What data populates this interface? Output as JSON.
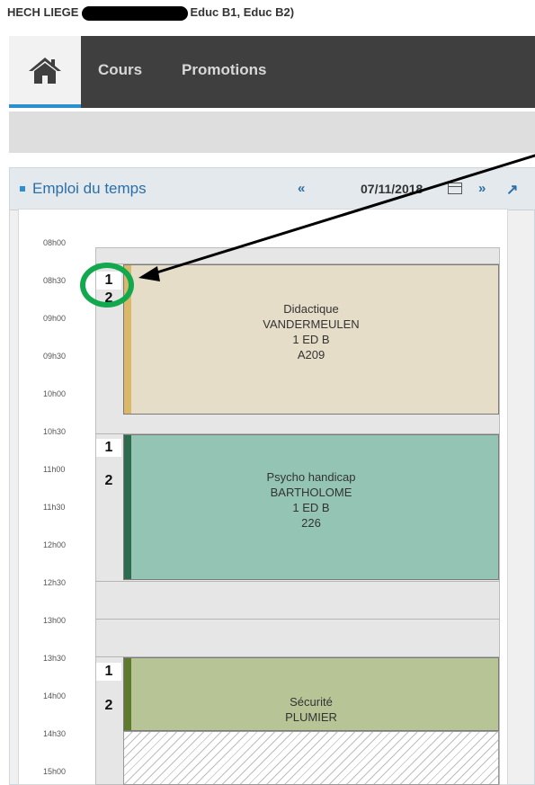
{
  "header": {
    "title_prefix": "HECH LIEGE",
    "title_suffix": "Educ B1, Educ B2)"
  },
  "navbar": {
    "home_icon": "home-icon",
    "links": [
      {
        "label": "Cours"
      },
      {
        "label": "Promotions"
      }
    ]
  },
  "schedule": {
    "title": "Emploi du temps",
    "prev_icon": "double-chevron-left-icon",
    "date": "07/11/2018",
    "calendar_icon": "calendar-icon",
    "next_icon": "double-chevron-right-icon",
    "expand_icon": "expand-arrow-icon",
    "times": [
      "08h00",
      "08h30",
      "09h00",
      "09h30",
      "10h00",
      "10h30",
      "11h00",
      "11h30",
      "12h00",
      "12h30",
      "13h00",
      "13h30",
      "14h00",
      "14h30",
      "15h00"
    ],
    "slot_one": "1",
    "slot_two": "2",
    "courses": [
      {
        "subject": "Didactique",
        "teacher": "VANDERMEULEN",
        "group": "1 ED B",
        "room": "A209",
        "color": "#e6ddc8",
        "accent": "#d9b86a"
      },
      {
        "subject": "Psycho handicap",
        "teacher": "BARTHOLOME",
        "group": "1 ED B",
        "room": "226",
        "color": "#93c4b4",
        "accent": "#2e6b4e"
      },
      {
        "subject": "Sécurité",
        "teacher": "PLUMIER",
        "color": "#b7c596",
        "accent": "#5e7a2e"
      }
    ]
  },
  "annotation": {
    "ring_color": "#12a84d",
    "arrow_color": "#000000"
  }
}
